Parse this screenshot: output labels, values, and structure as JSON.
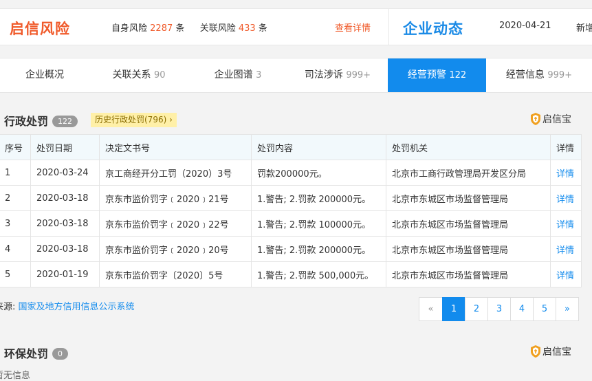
{
  "topbar": {
    "risk_brand": "启信风险",
    "self_risk_label": "自身风险",
    "self_risk_count": "2287",
    "self_risk_unit": "条",
    "related_risk_label": "关联风险",
    "related_risk_count": "433",
    "related_risk_unit": "条",
    "view_detail": "查看详情",
    "news_brand": "企业动态",
    "news_date": "2020-04-21",
    "news_text": "新增"
  },
  "tabs": [
    {
      "label": "企业概况",
      "count": ""
    },
    {
      "label": "关联关系",
      "count": "90"
    },
    {
      "label": "企业图谱",
      "count": "3"
    },
    {
      "label": "司法涉诉",
      "count": "999+"
    },
    {
      "label": "经营预警",
      "count": "122"
    },
    {
      "label": "经营信息",
      "count": "999+"
    }
  ],
  "admin_penalty": {
    "title": "行政处罚",
    "count": "122",
    "history_tag": "历史行政处罚(796)",
    "history_arrow": "›",
    "brand": "启信宝",
    "columns": [
      "序号",
      "处罚日期",
      "决定文书号",
      "处罚内容",
      "处罚机关",
      "详情"
    ],
    "rows": [
      [
        "1",
        "2020-03-24",
        "京工商经开分工罚（2020）3号",
        "罚款200000元。",
        "北京市工商行政管理局开发区分局",
        "详情"
      ],
      [
        "2",
        "2020-03-18",
        "京东市监价罚字﹝2020﹞21号",
        "1.警告; 2.罚款 200000元。",
        "北京市东城区市场监督管理局",
        "详情"
      ],
      [
        "3",
        "2020-03-18",
        "京东市监价罚字﹝2020﹞22号",
        "1.警告; 2.罚款 100000元。",
        "北京市东城区市场监督管理局",
        "详情"
      ],
      [
        "4",
        "2020-03-18",
        "京东市监价罚字﹝2020﹞20号",
        "1.警告; 2.罚款 200000元。",
        "北京市东城区市场监督管理局",
        "详情"
      ],
      [
        "5",
        "2020-01-19",
        "京东市监价罚字〔2020〕5号",
        "1.警告; 2.罚款 500,000元。",
        "北京市东城区市场监督管理局",
        "详情"
      ]
    ],
    "source_label": "来源:",
    "source_link": "国家及地方信用信息公示系统",
    "pagination": {
      "prev": "«",
      "pages": [
        "1",
        "2",
        "3",
        "4",
        "5"
      ],
      "next": "»",
      "current": "1"
    }
  },
  "env_penalty": {
    "title": "环保处罚",
    "count": "0",
    "brand": "启信宝",
    "empty_text": "暂无信息"
  },
  "colors": {
    "accent": "#128bed",
    "risk": "#f05a2a",
    "tag_bg": "#fff0a8"
  }
}
